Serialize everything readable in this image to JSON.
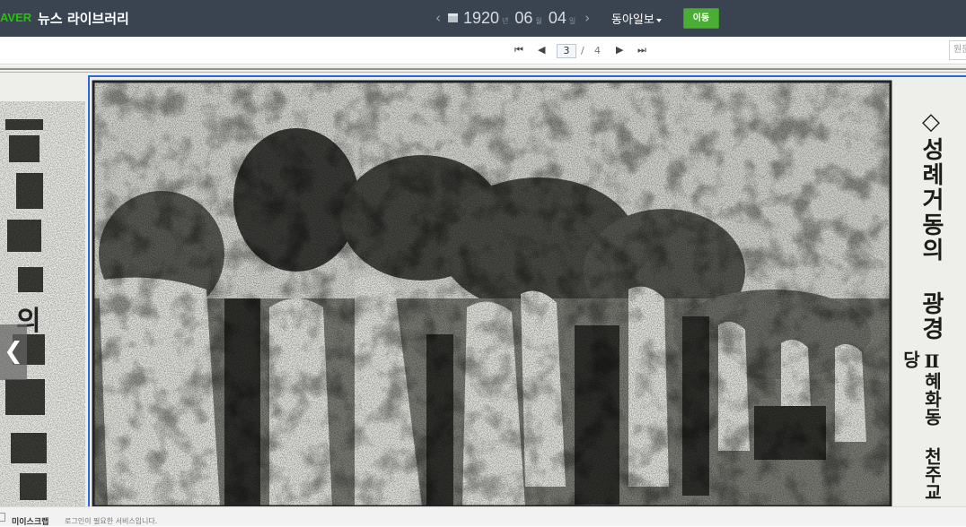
{
  "header": {
    "logo": "AVER",
    "title": "뉴스 라이브러리",
    "date": {
      "year": "1920",
      "year_unit": "년",
      "month": "06",
      "month_unit": "월",
      "day": "04",
      "day_unit": "일"
    },
    "newspaper": "동아일보",
    "go_button": "이동"
  },
  "pagination": {
    "current": "3",
    "separator": "/",
    "total": "4"
  },
  "search": {
    "placeholder": "원문"
  },
  "article": {
    "right_headline": "성례거동의 광경",
    "right_subtitle": "혜화동 천주교당",
    "left_chars": "의"
  },
  "footer": {
    "scrap_label": "미이스크랩",
    "message": "로그인이 필요한 서비스입니다."
  },
  "colors": {
    "header_bg": "#3a4350",
    "naver_green": "#1ec800",
    "go_button": "#4aad34",
    "selection_border": "#2e66e0"
  }
}
